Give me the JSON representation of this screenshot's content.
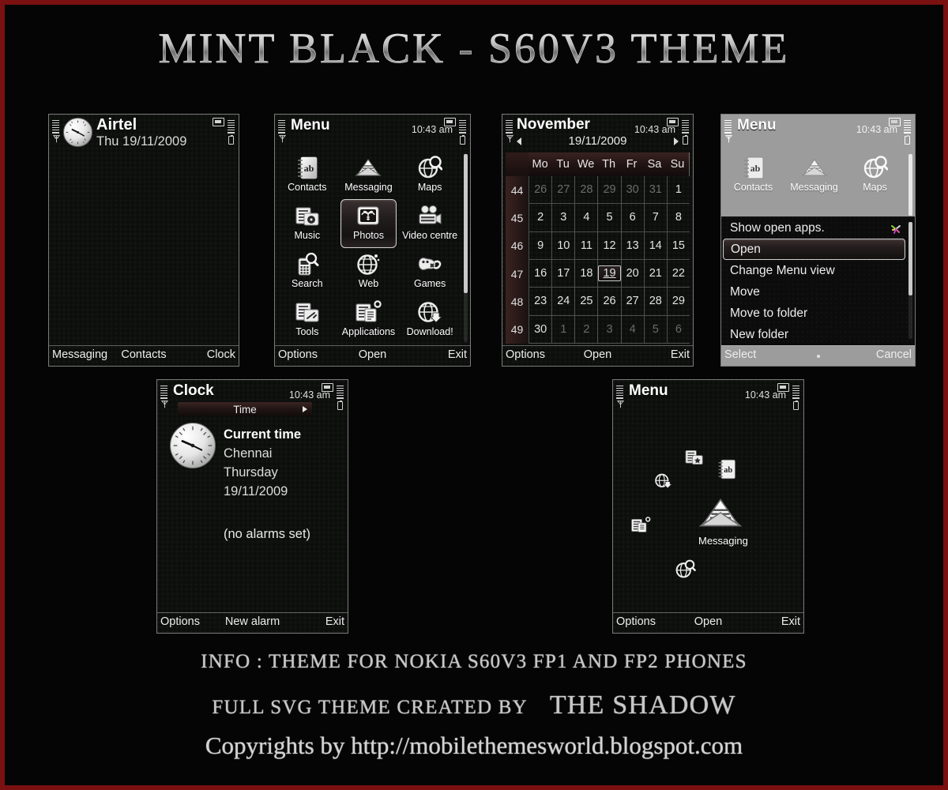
{
  "banner": {
    "title": "MINT BLACK - S60V3 THEME"
  },
  "theme_colors": {
    "page_border": "#7a1010",
    "page_background": "#050505",
    "screen_background": "#0e100e",
    "screen_border": "#7a7a7a",
    "text_primary": "#ffffff",
    "text_secondary": "#dcdcdc",
    "highlight_gradient_top": "#3a2f2e",
    "accent_red": "#3a2321"
  },
  "screens": [
    {
      "id": "standby",
      "name": "standby-screen",
      "operator": "Airtel",
      "date": "Thu 19/11/2009",
      "clock_icon": "analog-clock-icon",
      "status": {
        "signal": "signal-bars-icon",
        "antenna": "antenna-icon",
        "envelope": "envelope-indicator-icon",
        "battery": "battery-icon"
      },
      "softkeys": {
        "left": "Messaging",
        "center": "Contacts",
        "right": "Clock"
      }
    },
    {
      "id": "menu-grid",
      "name": "menu-grid-screen",
      "title": "Menu",
      "clock": "10:43 am",
      "selected": "Photos",
      "items": [
        {
          "label": "Contacts",
          "icon": "contacts-book-icon"
        },
        {
          "label": "Messaging",
          "icon": "envelope-icon"
        },
        {
          "label": "Maps",
          "icon": "globe-magnifier-icon"
        },
        {
          "label": "Music",
          "icon": "music-folder-icon"
        },
        {
          "label": "Photos",
          "icon": "photos-palm-icon"
        },
        {
          "label": "Video centre",
          "icon": "video-camera-icon"
        },
        {
          "label": "Search",
          "icon": "phone-magnifier-icon"
        },
        {
          "label": "Web",
          "icon": "globe-icon"
        },
        {
          "label": "Games",
          "icon": "gamepad-icon"
        },
        {
          "label": "Tools",
          "icon": "tools-folder-icon"
        },
        {
          "label": "Applications",
          "icon": "applications-folder-icon"
        },
        {
          "label": "Download!",
          "icon": "globe-download-icon"
        }
      ],
      "softkeys": {
        "left": "Options",
        "center": "Open",
        "right": "Exit"
      }
    },
    {
      "id": "calendar",
      "name": "calendar-screen",
      "title": "November",
      "clock": "10:43 am",
      "date": "19/11/2009",
      "weekday_headers": [
        "Mo",
        "Tu",
        "We",
        "Th",
        "Fr",
        "Sa",
        "Su"
      ],
      "week_numbers": [
        44,
        45,
        46,
        47,
        48,
        49
      ],
      "weeks": [
        [
          {
            "d": 26,
            "off": true
          },
          {
            "d": 27,
            "off": true
          },
          {
            "d": 28,
            "off": true
          },
          {
            "d": 29,
            "off": true
          },
          {
            "d": 30,
            "off": true
          },
          {
            "d": 31,
            "off": true
          },
          {
            "d": 1,
            "off": false
          }
        ],
        [
          {
            "d": 2
          },
          {
            "d": 3
          },
          {
            "d": 4
          },
          {
            "d": 5
          },
          {
            "d": 6
          },
          {
            "d": 7
          },
          {
            "d": 8
          }
        ],
        [
          {
            "d": 9
          },
          {
            "d": 10
          },
          {
            "d": 11
          },
          {
            "d": 12
          },
          {
            "d": 13
          },
          {
            "d": 14
          },
          {
            "d": 15
          }
        ],
        [
          {
            "d": 16
          },
          {
            "d": 17
          },
          {
            "d": 18
          },
          {
            "d": 19,
            "today": true
          },
          {
            "d": 20
          },
          {
            "d": 21
          },
          {
            "d": 22
          }
        ],
        [
          {
            "d": 23
          },
          {
            "d": 24
          },
          {
            "d": 25
          },
          {
            "d": 26
          },
          {
            "d": 27
          },
          {
            "d": 28
          },
          {
            "d": 29
          }
        ],
        [
          {
            "d": 30
          },
          {
            "d": 1,
            "off": true
          },
          {
            "d": 2,
            "off": true
          },
          {
            "d": 3,
            "off": true
          },
          {
            "d": 4,
            "off": true
          },
          {
            "d": 5,
            "off": true
          },
          {
            "d": 6,
            "off": true
          }
        ]
      ],
      "softkeys": {
        "left": "Options",
        "center": "Open",
        "right": "Exit"
      }
    },
    {
      "id": "menu-options-popup",
      "name": "menu-options-popup-screen",
      "title": "Menu",
      "clock": "10:43 am",
      "background_items": [
        {
          "label": "Contacts",
          "icon": "contacts-book-icon"
        },
        {
          "label": "Messaging",
          "icon": "envelope-icon"
        },
        {
          "label": "Maps",
          "icon": "globe-magnifier-icon"
        }
      ],
      "popup_items": [
        {
          "label": "Show open apps.",
          "selected": false,
          "badge": "pinwheel-icon"
        },
        {
          "label": "Open",
          "selected": true
        },
        {
          "label": "Change Menu view",
          "selected": false
        },
        {
          "label": "Move",
          "selected": false
        },
        {
          "label": "Move to folder",
          "selected": false
        },
        {
          "label": "New folder",
          "selected": false
        }
      ],
      "softkeys": {
        "left": "Select",
        "center": "",
        "right": "Cancel"
      }
    },
    {
      "id": "clock",
      "name": "clock-screen",
      "title": "Clock",
      "clock": "10:43 am",
      "tab": "Time",
      "lines": {
        "heading": "Current time",
        "city": "Chennai",
        "weekday": "Thursday",
        "date": "19/11/2009",
        "alarms": "(no alarms set)"
      },
      "softkeys": {
        "left": "Options",
        "center": "New alarm",
        "right": "Exit"
      }
    },
    {
      "id": "horseshoe-menu",
      "name": "horseshoe-menu-screen",
      "title": "Menu",
      "clock": "10:43 am",
      "focused_label": "Messaging",
      "scattered_icons": [
        {
          "icon": "tools-folder-icon"
        },
        {
          "icon": "contacts-book-icon"
        },
        {
          "icon": "globe-download-icon"
        },
        {
          "icon": "applications-folder-icon"
        },
        {
          "icon": "envelope-icon"
        },
        {
          "icon": "globe-magnifier-icon"
        }
      ],
      "softkeys": {
        "left": "Options",
        "center": "Open",
        "right": "Exit"
      }
    }
  ],
  "footer": {
    "line1": "INFO :  THEME FOR NOKIA S60V3 FP1 AND FP2 PHONES",
    "line2_a": "FULL SVG THEME  CREATED BY",
    "line2_b": "THE SHADOW",
    "line3": "Copyrights by http://mobilethemesworld.blogspot.com"
  }
}
